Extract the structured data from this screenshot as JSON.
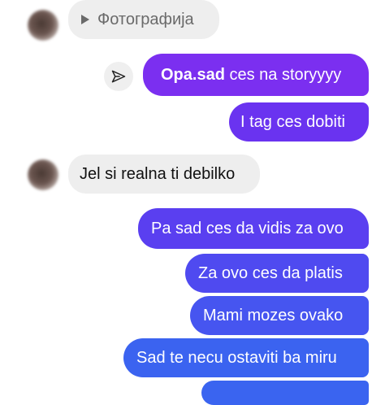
{
  "messages": {
    "photo_attachment_label": "Фотографија",
    "story_reply_username": "Opa.sad",
    "story_reply_text": " ces na storyyyy",
    "m2": "I tag ces dobiti",
    "m3": "Jel si realna ti debilko",
    "m4": "Pa sad ces da vidis za ovo",
    "m5": "Za ovo ces da platis",
    "m6": "Mami mozes ovako",
    "m7": "Sad te necu ostaviti ba miru"
  },
  "icons": {
    "share": "send-icon",
    "play": "play-icon"
  },
  "colors": {
    "purple": "#7b2ff0",
    "indigo": "#5a3ff0",
    "blue": "#3b63f0",
    "incoming_bg": "#eeeeee"
  }
}
